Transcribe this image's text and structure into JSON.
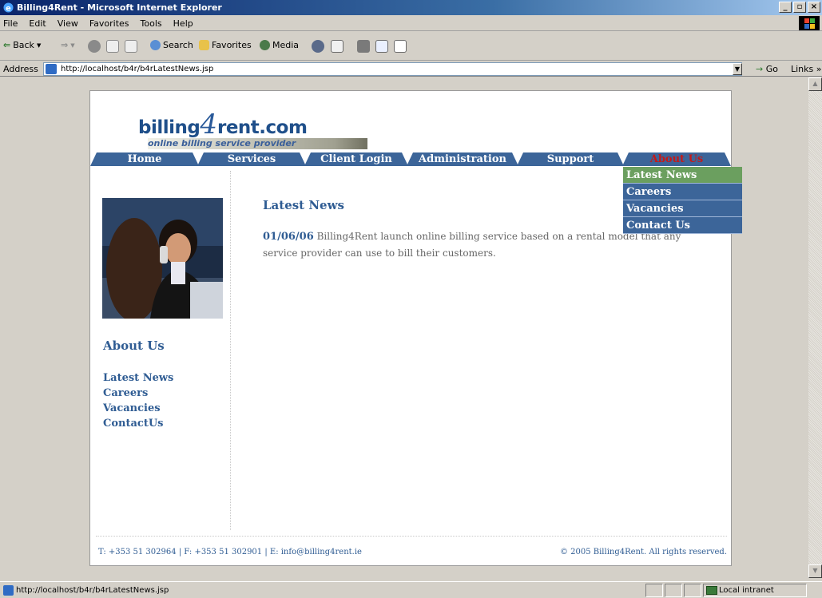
{
  "window": {
    "title": "Billing4Rent - Microsoft Internet Explorer"
  },
  "menu": [
    "File",
    "Edit",
    "View",
    "Favorites",
    "Tools",
    "Help"
  ],
  "toolbar": {
    "back": "Back",
    "search": "Search",
    "favorites": "Favorites",
    "media": "Media"
  },
  "address": {
    "label": "Address",
    "url": "http://localhost/b4r/b4rLatestNews.jsp",
    "go": "Go",
    "links": "Links »"
  },
  "site": {
    "logo": {
      "part1": "billing",
      "four": "4",
      "part2": "rent.com",
      "tagline": "online billing service provider"
    },
    "nav": [
      "Home",
      "Services",
      "Client Login",
      "Administration",
      "Support",
      "About Us"
    ],
    "dropdown": [
      "Latest News",
      "Careers",
      "Vacancies",
      "Contact Us"
    ],
    "sidebar": {
      "heading": "About Us",
      "links": [
        "Latest News",
        "Careers",
        "Vacancies",
        "ContactUs"
      ]
    },
    "content": {
      "heading": "Latest News",
      "news_date": "01/06/06",
      "news_text": " Billing4Rent launch online billing service based on a rental model that any service provider can use to bill their customers."
    },
    "footer": {
      "contact": "T: +353 51 302964 | F: +353 51 302901 | E: info@billing4rent.ie",
      "copyright": "© 2005 Billing4Rent. All rights reserved."
    }
  },
  "status": {
    "text": "http://localhost/b4r/b4rLatestNews.jsp",
    "zone": "Local intranet"
  }
}
